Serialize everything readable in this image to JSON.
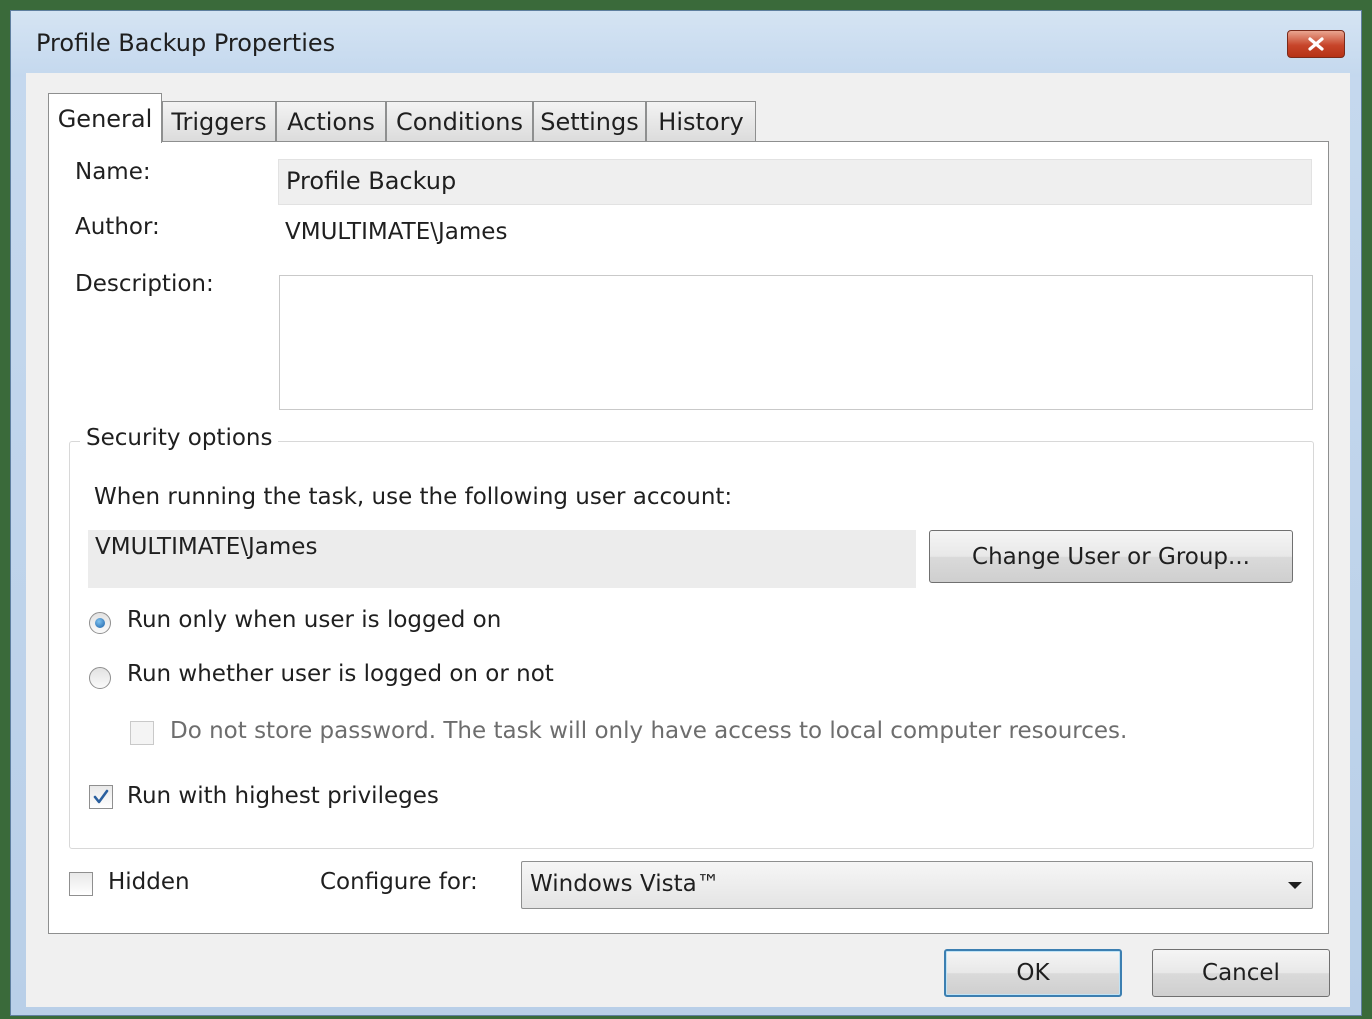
{
  "window": {
    "title": "Profile Backup Properties"
  },
  "tabs": [
    {
      "label": "General",
      "active": true
    },
    {
      "label": "Triggers"
    },
    {
      "label": "Actions"
    },
    {
      "label": "Conditions"
    },
    {
      "label": "Settings"
    },
    {
      "label": "History"
    }
  ],
  "general": {
    "name_label": "Name:",
    "name_value": "Profile Backup",
    "author_label": "Author:",
    "author_value": "VMULTIMATE\\James",
    "description_label": "Description:",
    "description_value": ""
  },
  "security": {
    "group_title": "Security options",
    "account_prompt": "When running the task, use the following user account:",
    "account_value": "VMULTIMATE\\James",
    "change_button": "Change User or Group...",
    "radio_logged_on": {
      "label": "Run only when user is logged on",
      "checked": true
    },
    "radio_whether": {
      "label": "Run whether user is logged on or not",
      "checked": false
    },
    "no_store_password": {
      "label": "Do not store password.  The task will only have access to local computer resources.",
      "checked": false,
      "enabled": false
    },
    "highest_privileges": {
      "label": "Run with highest privileges",
      "checked": true
    }
  },
  "bottom": {
    "hidden_label": "Hidden",
    "hidden_checked": false,
    "configure_label": "Configure for:",
    "configure_value": "Windows Vista™"
  },
  "buttons": {
    "ok": "OK",
    "cancel": "Cancel"
  },
  "icons": {
    "close": "close-icon",
    "radio": "radio-button",
    "checkbox": "checkbox",
    "dropdown": "chevron-down-icon"
  },
  "colors": {
    "title_bar": "#c6d9ee",
    "close_button": "#c7452a",
    "default_button_border": "#3c7fb1",
    "panel": "#ffffff"
  }
}
